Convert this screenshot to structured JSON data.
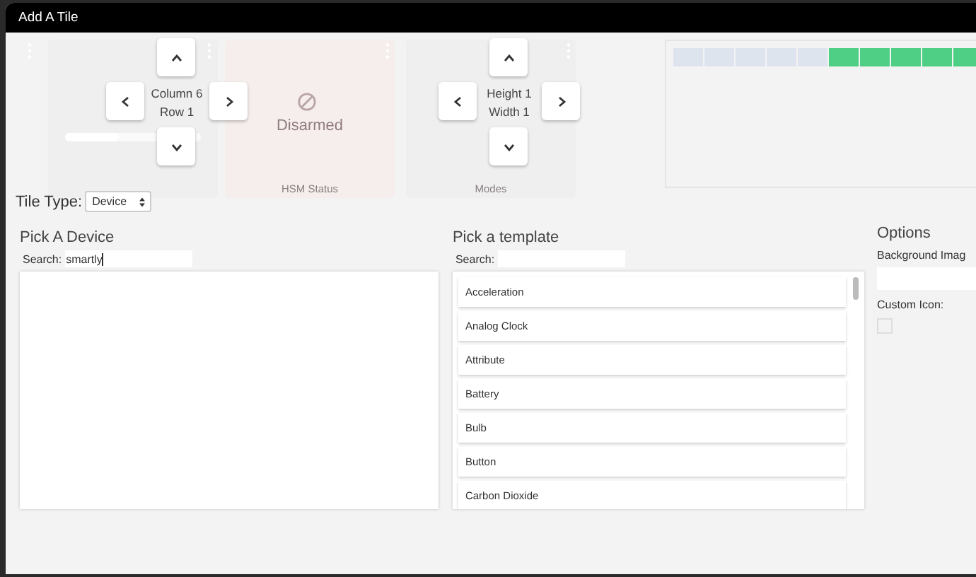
{
  "window": {
    "title": "Add A Tile"
  },
  "tiles": [
    {
      "kind": "slider",
      "level": 0.4
    },
    {
      "kind": "status",
      "state": "Disarmed",
      "label": "HSM Status"
    },
    {
      "kind": "plain",
      "label": "Modes"
    }
  ],
  "position_control": {
    "lines": [
      "Column 6",
      "Row 1"
    ]
  },
  "size_control": {
    "lines": [
      "Height 1",
      "Width 1"
    ]
  },
  "grid_preview": {
    "cells": [
      {
        "filled": false
      },
      {
        "filled": false
      },
      {
        "filled": false
      },
      {
        "filled": false
      },
      {
        "filled": false
      },
      {
        "filled": true
      },
      {
        "filled": true
      },
      {
        "filled": true
      },
      {
        "filled": true
      },
      {
        "filled": true
      }
    ]
  },
  "tile_type": {
    "label": "Tile Type:",
    "value": "Device"
  },
  "device_picker": {
    "title": "Pick A Device",
    "search_label": "Search:",
    "search_value": "smartly"
  },
  "template_picker": {
    "title": "Pick a template",
    "search_label": "Search:",
    "items": [
      "Acceleration",
      "Analog Clock",
      "Attribute",
      "Battery",
      "Bulb",
      "Button",
      "Carbon Dioxide"
    ]
  },
  "options": {
    "title": "Options",
    "background_label": "Background Imag",
    "custom_icon_label": "Custom Icon:",
    "custom_icon_checked": false
  }
}
